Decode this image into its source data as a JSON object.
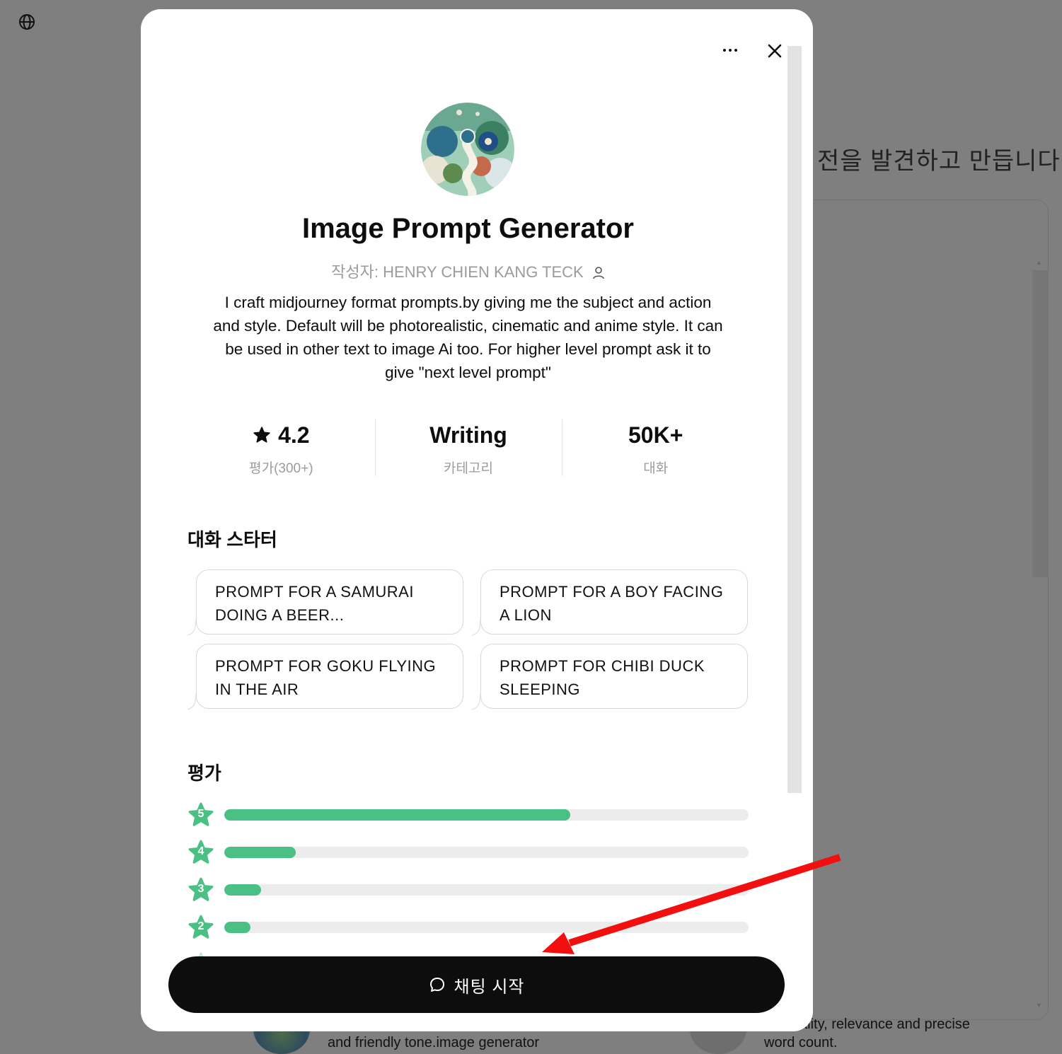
{
  "background": {
    "heading": "전을 발견하고 만듭니다.",
    "card_left_description": "and friendly tone.image generator",
    "card_right_description_line1": "on quality, relevance and precise",
    "card_right_description_line2": "word count."
  },
  "modal": {
    "title": "Image Prompt Generator",
    "author": "작성자: HENRY CHIEN KANG TECK",
    "description": "I craft midjourney format prompts.by giving me the subject and action and style. Default will be photorealistic, cinematic and anime style. It can be used in other text to image Ai too. For higher level prompt ask it to give \"next level prompt\"",
    "stats": [
      {
        "value": "4.2",
        "label": "평가(300+)",
        "icon": "star-icon"
      },
      {
        "value": "Writing",
        "label": "카테고리"
      },
      {
        "value": "50K+",
        "label": "대화"
      }
    ],
    "starters_title": "대화 스타터",
    "starters": [
      "PROMPT FOR A SAMURAI DOING A BEER...",
      "PROMPT FOR A BOY FACING A LION",
      "PROMPT FOR GOKU FLYING IN THE AIR",
      "PROMPT FOR CHIBI DUCK SLEEPING"
    ],
    "ratings_title": "평가",
    "ratings": [
      {
        "stars": "5",
        "fraction": 0.66
      },
      {
        "stars": "4",
        "fraction": 0.136
      },
      {
        "stars": "3",
        "fraction": 0.07
      },
      {
        "stars": "2",
        "fraction": 0.05
      }
    ],
    "start_button": "채팅 시작"
  },
  "colors": {
    "accent_green": "#4ac084",
    "annotation_arrow": "#f20f0f",
    "button_bg": "#0d0d0d"
  }
}
